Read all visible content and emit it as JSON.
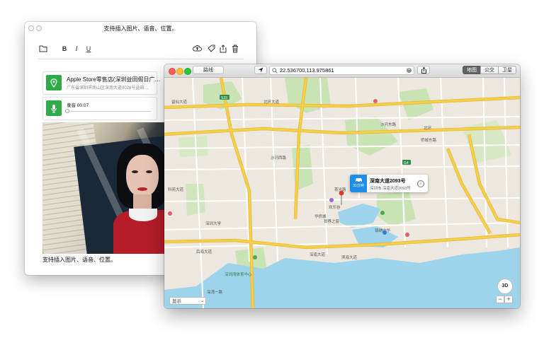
{
  "note_window": {
    "title": "支持插入图片、语音、位置。",
    "toolbar": {
      "bold": "B",
      "italic": "I",
      "underline": "U"
    },
    "location_card": {
      "title": "Apple Store零售店(深圳益田假日广…",
      "address": "广东省深圳市南山区深南大道9028号益田…"
    },
    "audio_card": {
      "label": "录音 00:07"
    },
    "caption": "支持插入图片、语音、位置。"
  },
  "maps_window": {
    "directions_label": "路线",
    "search_value": "22.536700,113.975861",
    "view_tabs": [
      {
        "label": "地图",
        "active": true
      },
      {
        "label": "公交",
        "active": false
      },
      {
        "label": "卫星",
        "active": false
      }
    ],
    "callout": {
      "eta": "31分钟",
      "title": "深南大道2093号",
      "subtitle": "深圳市 深南大道2093号"
    },
    "show_select": "显示",
    "btn_3d": "3D",
    "zoom_out": "−",
    "zoom_in": "+",
    "map_labels": [
      "北环大道",
      "深南大道",
      "滨海大道",
      "沙河东路",
      "侨城东路",
      "北环",
      "华侨城",
      "欢乐谷",
      "世界之窗",
      "锦绣中华",
      "深圳大学",
      "后海大道",
      "科苑大道",
      "深圳湾体育中心",
      "茶光路",
      "留仙大道",
      "沙河西路",
      "深湾一路",
      "G4",
      "S33"
    ],
    "colors": {
      "water": "#9ed3ec",
      "park": "#c9e3b4",
      "road_major": "#f6cf4a",
      "pin": "#e23b2e",
      "accent": "#1e8ee8"
    }
  }
}
